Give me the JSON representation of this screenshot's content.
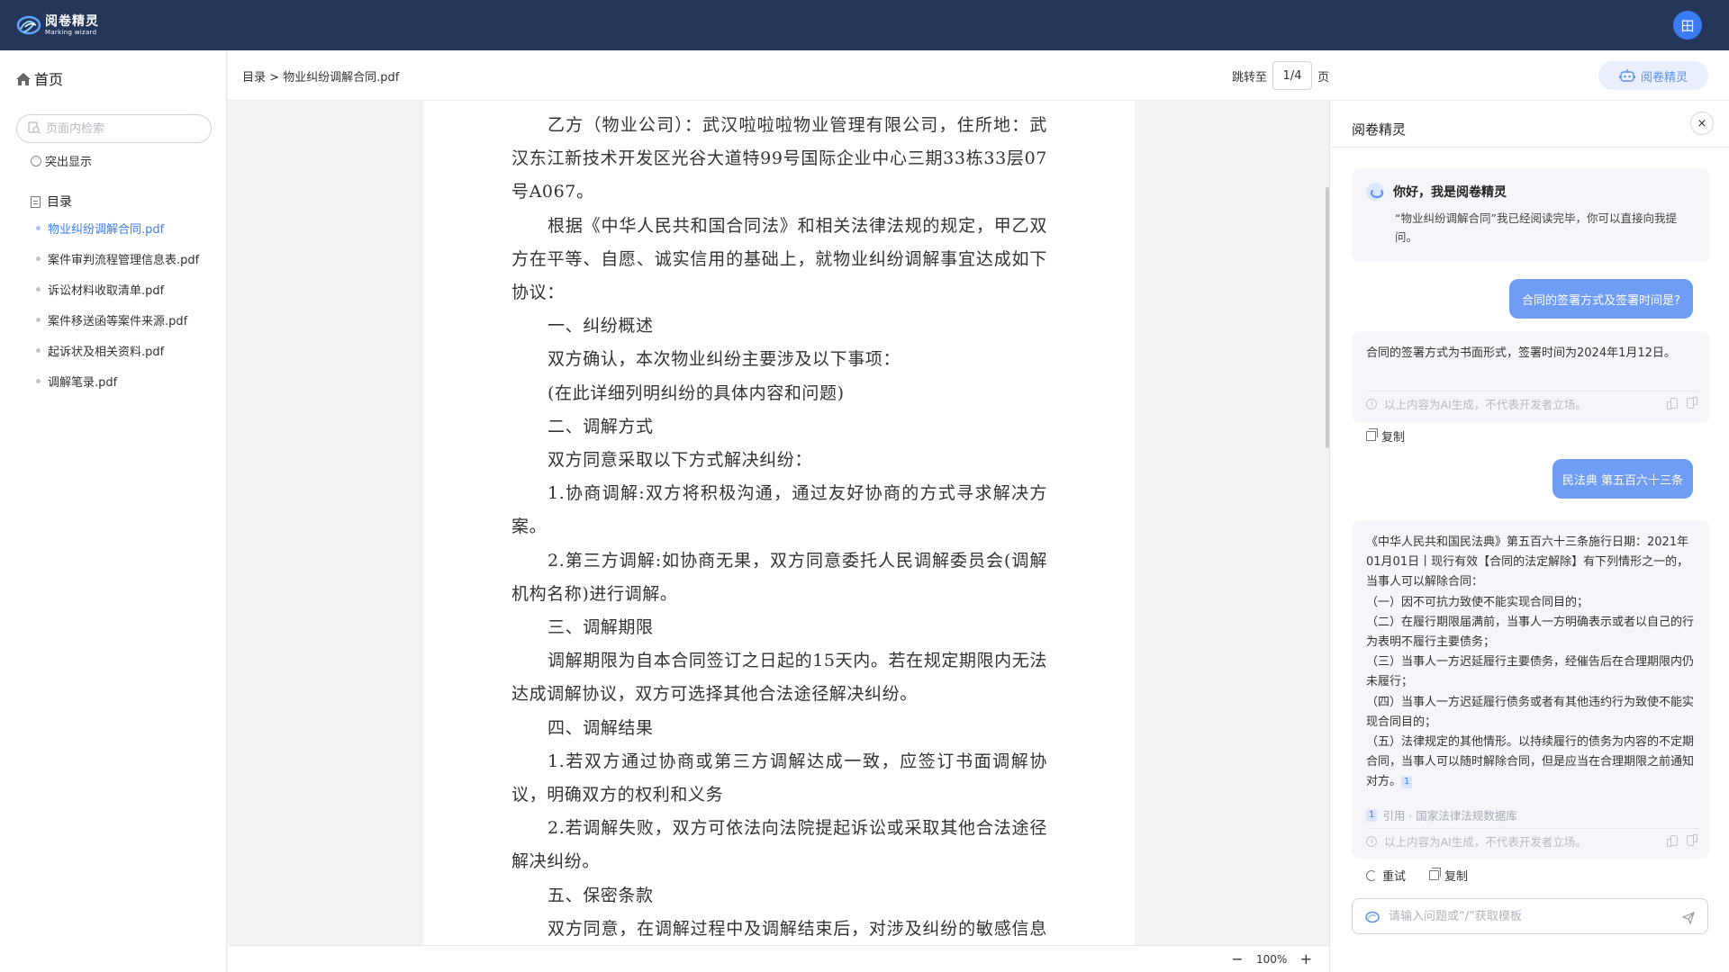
{
  "app": {
    "logo_cn": "阅卷精灵",
    "logo_en": "Marking wizard",
    "user_avatar": "田",
    "accent_color": "#3a7bf6",
    "header_color": "#24365a"
  },
  "sidebar": {
    "home_label": "首页",
    "search_placeholder": "页面内检索",
    "highlight_label": "突出显示",
    "toc_label": "目录",
    "files": [
      "物业纠纷调解合同.pdf",
      "案件审判流程管理信息表.pdf",
      "诉讼材料收取清单.pdf",
      "案件移送函等案件来源.pdf",
      "起诉状及相关资料.pdf",
      "调解笔录.pdf"
    ],
    "active_index": 0
  },
  "toolbar": {
    "breadcrumb": "目录 > 物业纠纷调解合同.pdf",
    "jump_label": "跳转至",
    "page_value": "1/4",
    "page_suffix": "页",
    "agent_button": "阅卷精灵"
  },
  "document": {
    "paragraphs": [
      {
        "text": "乙方（物业公司）：武汉啦啦啦物业管理有限公司，住所地：武汉东江新技术开发区光谷大道特99号国际企业中心三期33栋33层07号A067。",
        "indent": true
      },
      {
        "text": "根据《中华人民共和国合同法》和相关法律法规的规定，甲乙双方在平等、自愿、诚实信用的基础上，就物业纠纷调解事宜达成如下协议：",
        "indent": true
      },
      {
        "text": "一、纠纷概述",
        "indent": true
      },
      {
        "text": "双方确认，本次物业纠纷主要涉及以下事项：",
        "indent": true
      },
      {
        "text": "(在此详细列明纠纷的具体内容和问题)",
        "indent": true
      },
      {
        "text": "二、调解方式",
        "indent": true
      },
      {
        "text": "双方同意采取以下方式解决纠纷：",
        "indent": true
      },
      {
        "text": "1.协商调解:双方将积极沟通，通过友好协商的方式寻求解决方案。",
        "indent": true
      },
      {
        "text": "2.第三方调解:如协商无果，双方同意委托人民调解委员会(调解机构名称)进行调解。",
        "indent": true
      },
      {
        "text": "三、调解期限",
        "indent": true
      },
      {
        "text": "调解期限为自本合同签订之日起的15天内。若在规定期限内无法达成调解协议，双方可选择其他合法途径解决纠纷。",
        "indent": true
      },
      {
        "text": "四、调解结果",
        "indent": true
      },
      {
        "text": "1.若双方通过协商或第三方调解达成一致，应签订书面调解协议，明确双方的权利和义务",
        "indent": true
      },
      {
        "text": "2.若调解失败，双方可依法向法院提起诉讼或采取其他合法途径解决纠纷。",
        "indent": true
      },
      {
        "text": "五、保密条款",
        "indent": true
      },
      {
        "text": "双方同意，在调解过程中及调解结束后，对涉及纠纷的敏感信息予以保密。",
        "indent": true
      }
    ],
    "zoom": "100%",
    "zoom_minus": "−",
    "zoom_plus": "+"
  },
  "chat": {
    "title": "阅卷精灵",
    "close_symbol": "×",
    "greeting_title": "你好，我是阅卷精灵",
    "greeting_text": "“物业纠纷调解合同”我已经阅读完毕，你可以直接向我提问。",
    "question_1": "合同的签署方式及签署时间是?",
    "answer_1": "合同的签署方式为书面形式，签署时间为2024年1月12日。",
    "disclaimer": "以上内容为AI生成，不代表开发者立场。",
    "copy_label": "复制",
    "retry_label": "重试",
    "question_2": "民法典 第五百六十三条",
    "answer_2_lines": [
      "《中华人民共和国民法典》第五百六十三条施行日期：2021年01月01日丨现行有效【合同的法定解除】有下列情形之一的，当事人可以解除合同：",
      "（一）因不可抗力致使不能实现合同目的；",
      "（二）在履行期限届满前，当事人一方明确表示或者以自己的行为表明不履行主要债务；",
      "（三）当事人一方迟延履行主要债务，经催告后在合理期限内仍未履行；",
      "（四）当事人一方迟延履行债务或者有其他违约行为致使不能实现合同目的；",
      "（五）法律规定的其他情形。以持续履行的债务为内容的不定期合同，当事人可以随时解除合同，但是应当在合理期限之前通知对方。"
    ],
    "cite_number": "1",
    "cite_text": "引用 · 国家法律法规数据库",
    "input_placeholder": "请输入问题或“/”获取模板"
  }
}
